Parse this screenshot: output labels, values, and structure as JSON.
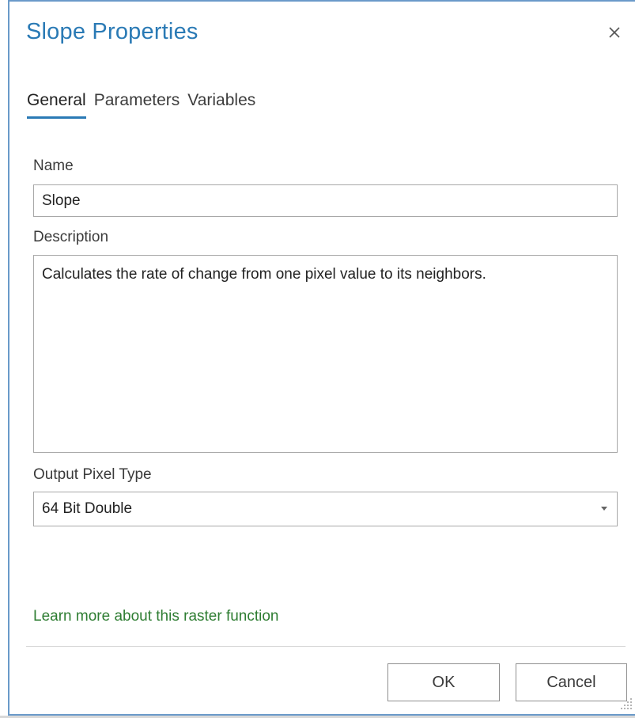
{
  "dialog": {
    "title": "Slope Properties",
    "close_icon": "close-icon"
  },
  "tabs": [
    {
      "label": "General",
      "active": true
    },
    {
      "label": "Parameters",
      "active": false
    },
    {
      "label": "Variables",
      "active": false
    }
  ],
  "form": {
    "name_label": "Name",
    "name_value": "Slope",
    "description_label": "Description",
    "description_value": "Calculates the rate of change from one pixel value to its neighbors.",
    "output_pixel_type_label": "Output Pixel Type",
    "output_pixel_type_value": "64 Bit Double"
  },
  "learn_more": "Learn more about this raster function",
  "buttons": {
    "ok": "OK",
    "cancel": "Cancel"
  },
  "colors": {
    "title": "#2a7ab5",
    "active_tab_underline": "#2a7ab5",
    "link": "#2e7d32",
    "window_border": "#6a9ac9"
  }
}
